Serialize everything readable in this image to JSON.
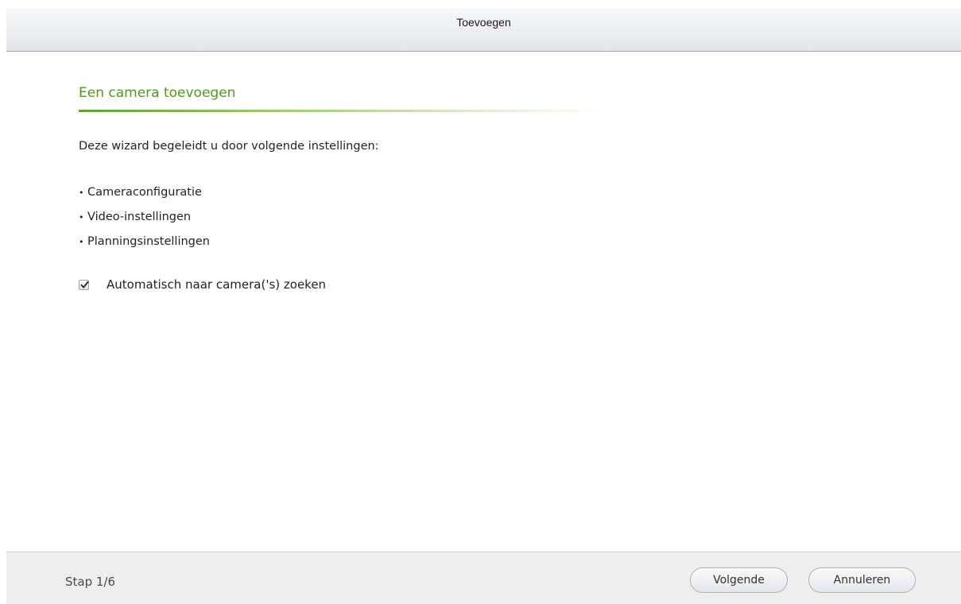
{
  "window": {
    "title": "Toevoegen"
  },
  "wizard": {
    "section_title": "Een camera toevoegen",
    "intro": "Deze wizard begeleidt u door volgende instellingen:",
    "steps": [
      "Cameraconfiguratie",
      "Video-instellingen",
      "Planningsinstellingen"
    ],
    "bullet": "•",
    "auto_search": {
      "label": "Automatisch naar camera('s) zoeken",
      "checked": true
    }
  },
  "footer": {
    "step_indicator": "Stap 1/6",
    "next_label": "Volgende",
    "cancel_label": "Annuleren"
  },
  "colors": {
    "accent_green": "#4d9a19",
    "title_bar": "#eceef1",
    "footer_bg": "#eeeeee"
  },
  "icons": {
    "checkbox": "checkmark-icon"
  }
}
